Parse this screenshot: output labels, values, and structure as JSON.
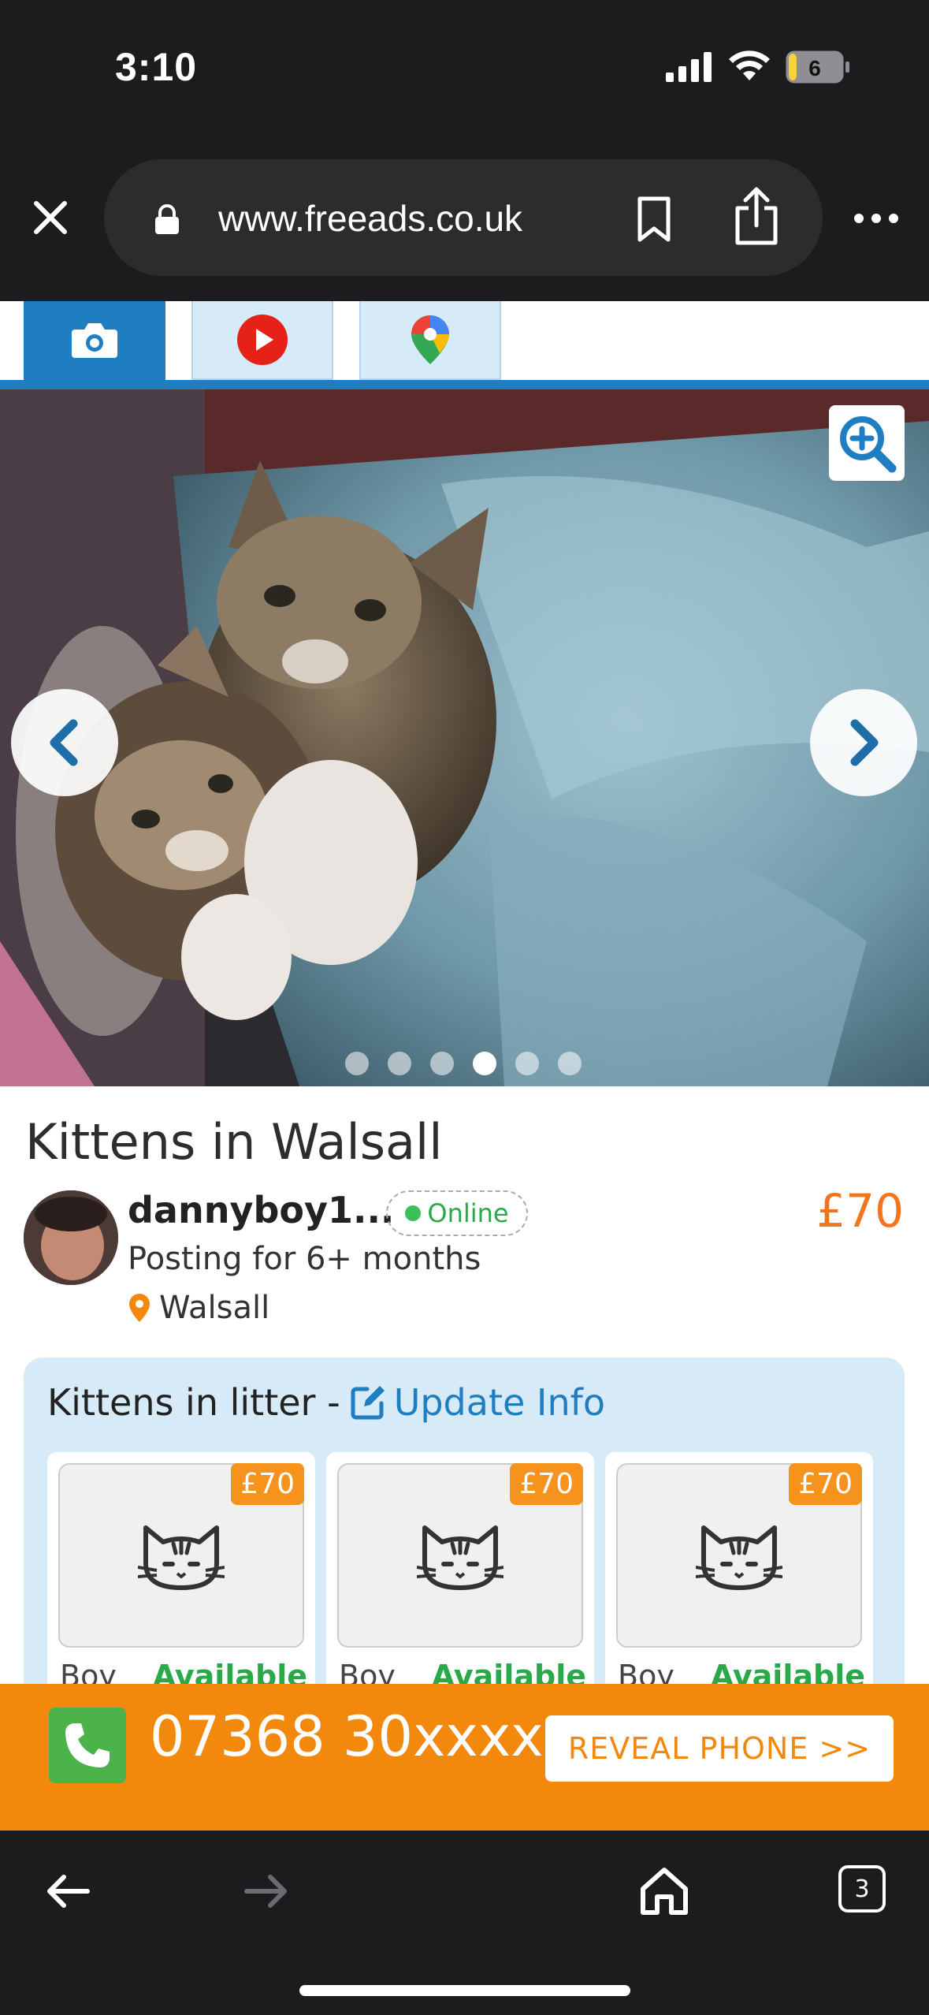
{
  "status_bar": {
    "time": "3:10",
    "battery_level": "6"
  },
  "browser": {
    "url": "www.freeads.co.uk",
    "tab_count": "3"
  },
  "media_tabs": [
    {
      "icon": "camera-icon",
      "active": true
    },
    {
      "icon": "youtube-icon",
      "active": false
    },
    {
      "icon": "maps-pin-icon",
      "active": false
    }
  ],
  "gallery": {
    "dot_count": 6,
    "active_dot": 3
  },
  "listing": {
    "title": "Kittens in Walsall",
    "username": "dannyboy1...",
    "online": "Online",
    "posting_for": "Posting for 6+ months",
    "location": "Walsall",
    "price": "£70"
  },
  "litter": {
    "heading": "Kittens in litter -",
    "update_label": "Update Info",
    "kittens": [
      {
        "price": "£70",
        "sex": "Boy",
        "status": "Available"
      },
      {
        "price": "£70",
        "sex": "Boy",
        "status": "Available"
      },
      {
        "price": "£70",
        "sex": "Boy",
        "status": "Available"
      }
    ]
  },
  "contact": {
    "phone": "07368 30xxxx",
    "reveal_label": "REVEAL PHONE >>"
  },
  "colors": {
    "brand_blue": "#1f7dc1",
    "accent_orange": "#f2890c",
    "price_orange": "#f2741b",
    "online_green": "#2ba84a"
  }
}
